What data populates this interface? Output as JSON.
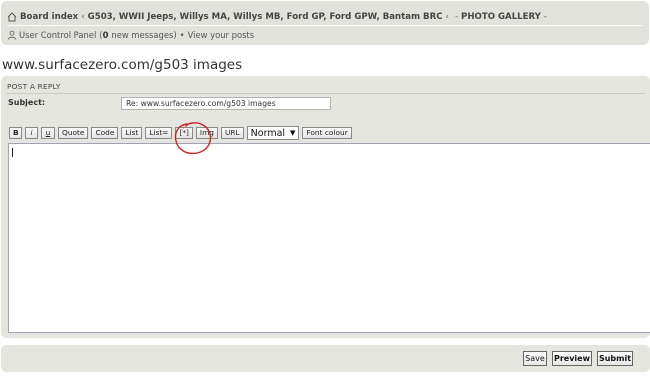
{
  "nav": {
    "crumbs": [
      "Board index",
      "G503, WWII Jeeps, Willys MA, Willys MB, Ford GP, Ford GPW, Bantam BRC",
      "PHOTO GALLERY"
    ],
    "separator": "‹",
    "trailing": "-",
    "ucp_label": "User Control Panel",
    "ucp_paren_open": "(",
    "ucp_count": "0",
    "ucp_suffix": "new messages)",
    "bullet": "•",
    "view_posts": "View your posts"
  },
  "page_title": "www.surfacezero.com/g503 images",
  "post": {
    "heading": "POST A REPLY",
    "subject_label": "Subject:",
    "subject_value": "Re: www.surfacezero.com/g503 images"
  },
  "toolbar": {
    "bold": "B",
    "italic": "i",
    "underline": "u",
    "quote": "Quote",
    "code": "Code",
    "list": "List",
    "list_eq": "List=",
    "list_item": "[*]",
    "img": "Img",
    "url": "URL",
    "font_size": "Normal",
    "font_colour": "Font colour"
  },
  "buttons": {
    "save": "Save",
    "preview": "Preview",
    "submit": "Submit"
  },
  "colors": {
    "bar_bg": "#e2e2dc",
    "panel_bg": "#e6e6e0",
    "annotation": "#d42020"
  },
  "icons": {
    "home": "home-icon",
    "user": "user-icon"
  }
}
